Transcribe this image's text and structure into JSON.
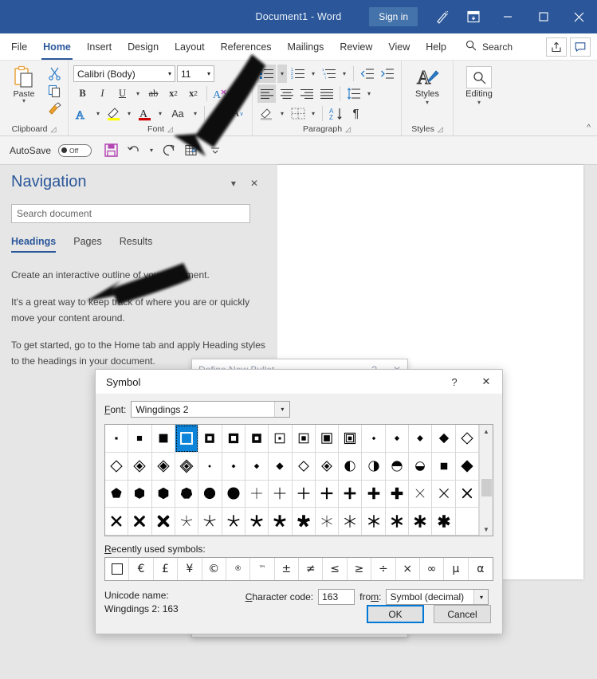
{
  "titlebar": {
    "document_title": "Document1",
    "separator": "-",
    "app_name": "Word",
    "sign_in": "Sign in",
    "minimize": "–",
    "maximize": "☐",
    "close": "✕"
  },
  "tabs": [
    {
      "label": "File",
      "active": false
    },
    {
      "label": "Home",
      "active": true
    },
    {
      "label": "Insert",
      "active": false
    },
    {
      "label": "Design",
      "active": false
    },
    {
      "label": "Layout",
      "active": false
    },
    {
      "label": "References",
      "active": false
    },
    {
      "label": "Mailings",
      "active": false
    },
    {
      "label": "Review",
      "active": false
    },
    {
      "label": "View",
      "active": false
    },
    {
      "label": "Help",
      "active": false
    }
  ],
  "search": {
    "label": "Search",
    "placeholder": "Search"
  },
  "ribbon": {
    "groups": [
      {
        "label": "Clipboard",
        "has_launcher": true
      },
      {
        "label": "Font",
        "has_launcher": true
      },
      {
        "label": "Paragraph",
        "has_launcher": true
      },
      {
        "label": "Styles",
        "has_launcher": true
      }
    ],
    "paste_label": "Paste",
    "font_name": "Calibri (Body)",
    "font_size": "11",
    "styles_label": "Styles",
    "editing_label": "Editing"
  },
  "quick_access": {
    "autosave_label": "AutoSave",
    "autosave_state": "Off"
  },
  "navigation": {
    "title": "Navigation",
    "search_placeholder": "Search document",
    "tabs": [
      {
        "label": "Headings",
        "active": true
      },
      {
        "label": "Pages",
        "active": false
      },
      {
        "label": "Results",
        "active": false
      }
    ],
    "body": [
      "Create an interactive outline of your document.",
      "It's a great way to keep track of where you are or quickly move your content around.",
      "To get started, go to the Home tab and apply Heading styles to the headings in your document."
    ]
  },
  "define_new_bullet_dialog": {
    "title": "Define New Bullet",
    "help": "?",
    "close": "✕"
  },
  "symbol_dialog": {
    "title": "Symbol",
    "help": "?",
    "close": "✕",
    "font_label": "Font:",
    "font_label_accel": "F",
    "font_value": "Wingdings 2",
    "recently_used_label": "Recently used symbols:",
    "recently_used_accel": "R",
    "recently_used": [
      "□",
      "€",
      "£",
      "¥",
      "©",
      "®",
      "™",
      "±",
      "≠",
      "≤",
      "≥",
      "÷",
      "×",
      "∞",
      "μ",
      "α"
    ],
    "unicode_name_label": "Unicode name:",
    "unicode_name_value": "Wingdings 2: 163",
    "character_code_label": "Character code:",
    "character_code_accel": "C",
    "character_code_value": "163",
    "from_label": "from:",
    "from_accel": "m",
    "from_value": "Symbol (decimal)",
    "ok_label": "OK",
    "cancel_label": "Cancel",
    "selected_index": 3,
    "accent_color": "#0b84d9",
    "grid_columns": 16,
    "grid_rows": 4,
    "glyphs": [
      "sq-xs",
      "sq-s",
      "sq-l",
      "sq-outline-sel",
      "sq-ring-sm",
      "sq-ring-md",
      "sq-ring-lg",
      "sq-frame-dot",
      "sq-frame-sm",
      "sq-frame-lg",
      "sq-double-frame",
      "dia-xxs",
      "dia-xs",
      "dia-s",
      "dia-m",
      "dia-outline",
      "dia-outline-2",
      "dia-inner-dia",
      "dia-inner-dia2",
      "dia-triple",
      "dot-xxs",
      "dot-xs",
      "dia-tiny",
      "dia-small-filled",
      "dia-hollow",
      "dia-hollow-dot",
      "half-left",
      "half-right",
      "half-top",
      "half-bottom",
      "sq-med",
      "dia-filled",
      "pentagon",
      "hexagon-1",
      "hexagon-2",
      "heptagon",
      "circle-1",
      "circle-2",
      "cross-thin-1",
      "cross-thin-2",
      "cross-3",
      "cross-4",
      "cross-5",
      "cross-6",
      "cross-7",
      "x-thin-1",
      "x-thin-2",
      "x-1",
      "x-2",
      "x-3",
      "x-4",
      "star5-thin",
      "star5-2",
      "star5-3",
      "star5-4",
      "star5-5",
      "star5-6",
      "star6-thin",
      "star6-2",
      "star6-3",
      "star6-4",
      "star6-5",
      "star6-6"
    ]
  },
  "colors": {
    "title_bar": "#2b579a",
    "accent": "#0b84d9",
    "ribbon_bg": "#f3f3f3",
    "workspace_bg": "#e6e6e6"
  }
}
